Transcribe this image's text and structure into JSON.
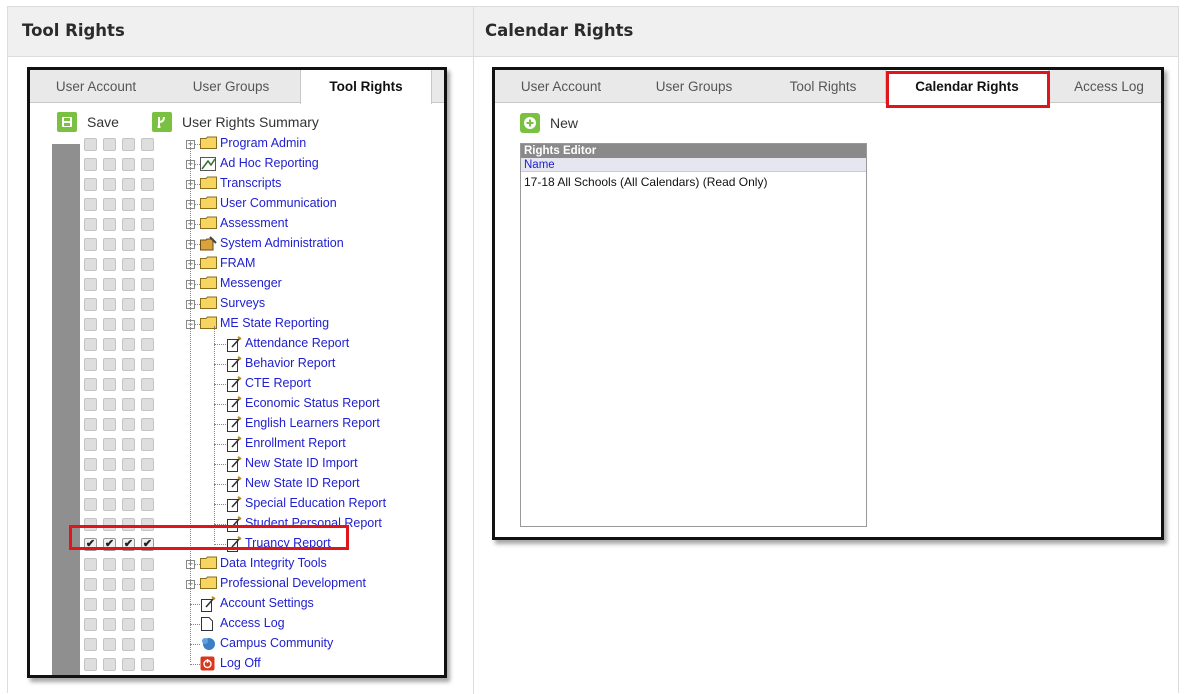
{
  "headers": {
    "left": "Tool Rights",
    "right": "Calendar Rights"
  },
  "left_shot": {
    "tabs": [
      "User Account",
      "User Groups",
      "Tool Rights"
    ],
    "active_tab": "Tool Rights",
    "toolbar": {
      "save": "Save",
      "summary": "User Rights Summary"
    },
    "tree": [
      {
        "label": "Program Admin",
        "icon": "folder-icon",
        "level": 1,
        "expander": "+",
        "checks": [
          false,
          false,
          false,
          false
        ]
      },
      {
        "label": "Ad Hoc Reporting",
        "icon": "report-icon",
        "level": 1,
        "expander": "+",
        "checks": [
          false,
          false,
          false,
          false
        ]
      },
      {
        "label": "Transcripts",
        "icon": "folder-icon",
        "level": 1,
        "expander": "+",
        "checks": [
          false,
          false,
          false,
          false
        ]
      },
      {
        "label": "User Communication",
        "icon": "folder-icon",
        "level": 1,
        "expander": "+",
        "checks": [
          false,
          false,
          false,
          false
        ]
      },
      {
        "label": "Assessment",
        "icon": "folder-icon",
        "level": 1,
        "expander": "+",
        "checks": [
          false,
          false,
          false,
          false
        ]
      },
      {
        "label": "System Administration",
        "icon": "admin-icon",
        "level": 1,
        "expander": "+",
        "checks": [
          false,
          false,
          false,
          false
        ]
      },
      {
        "label": "FRAM",
        "icon": "folder-icon",
        "level": 1,
        "expander": "+",
        "checks": [
          false,
          false,
          false,
          false
        ]
      },
      {
        "label": "Messenger",
        "icon": "folder-icon",
        "level": 1,
        "expander": "+",
        "checks": [
          false,
          false,
          false,
          false
        ]
      },
      {
        "label": "Surveys",
        "icon": "folder-icon",
        "level": 1,
        "expander": "+",
        "checks": [
          false,
          false,
          false,
          false
        ]
      },
      {
        "label": "ME State Reporting",
        "icon": "folder-icon",
        "level": 1,
        "expander": "−",
        "checks": [
          false,
          false,
          false,
          false
        ]
      },
      {
        "label": "Attendance Report",
        "icon": "tool-icon",
        "level": 2,
        "expander": "",
        "checks": [
          false,
          false,
          false,
          false
        ]
      },
      {
        "label": "Behavior Report",
        "icon": "tool-icon",
        "level": 2,
        "expander": "",
        "checks": [
          false,
          false,
          false,
          false
        ]
      },
      {
        "label": "CTE Report",
        "icon": "tool-icon",
        "level": 2,
        "expander": "",
        "checks": [
          false,
          false,
          false,
          false
        ]
      },
      {
        "label": "Economic Status Report",
        "icon": "tool-icon",
        "level": 2,
        "expander": "",
        "checks": [
          false,
          false,
          false,
          false
        ]
      },
      {
        "label": "English Learners Report",
        "icon": "tool-icon",
        "level": 2,
        "expander": "",
        "checks": [
          false,
          false,
          false,
          false
        ]
      },
      {
        "label": "Enrollment Report",
        "icon": "tool-icon",
        "level": 2,
        "expander": "",
        "checks": [
          false,
          false,
          false,
          false
        ]
      },
      {
        "label": "New State ID Import",
        "icon": "tool-icon",
        "level": 2,
        "expander": "",
        "checks": [
          false,
          false,
          false,
          false
        ]
      },
      {
        "label": "New State ID Report",
        "icon": "tool-icon",
        "level": 2,
        "expander": "",
        "checks": [
          false,
          false,
          false,
          false
        ]
      },
      {
        "label": "Special Education Report",
        "icon": "tool-icon",
        "level": 2,
        "expander": "",
        "checks": [
          false,
          false,
          false,
          false
        ]
      },
      {
        "label": "Student Personal Report",
        "icon": "tool-icon",
        "level": 2,
        "expander": "",
        "checks": [
          false,
          false,
          false,
          false
        ]
      },
      {
        "label": "Truancy Report",
        "icon": "tool-icon",
        "level": 2,
        "expander": "",
        "checks": [
          true,
          true,
          true,
          true
        ]
      },
      {
        "label": "Data Integrity Tools",
        "icon": "folder-icon",
        "level": 1,
        "expander": "+",
        "checks": [
          false,
          false,
          false,
          false
        ]
      },
      {
        "label": "Professional Development",
        "icon": "folder-icon",
        "level": 1,
        "expander": "+",
        "checks": [
          false,
          false,
          false,
          false
        ]
      },
      {
        "label": "Account Settings",
        "icon": "tool-icon",
        "level": 1,
        "expander": "",
        "checks": [
          false,
          false,
          false,
          false
        ]
      },
      {
        "label": "Access Log",
        "icon": "page-icon",
        "level": 1,
        "expander": "",
        "checks": [
          false,
          false,
          false,
          false
        ]
      },
      {
        "label": "Campus Community",
        "icon": "community-icon",
        "level": 1,
        "expander": "",
        "checks": [
          false,
          false,
          false,
          false
        ]
      },
      {
        "label": "Log Off",
        "icon": "logoff-icon",
        "level": 1,
        "expander": "",
        "checks": [
          false,
          false,
          false,
          false
        ]
      }
    ]
  },
  "right_shot": {
    "tabs": [
      "User Account",
      "User Groups",
      "Tool Rights",
      "Calendar Rights",
      "Access Log"
    ],
    "active_tab": "Calendar Rights",
    "new_label": "New",
    "rights_editor": {
      "title": "Rights Editor",
      "column": "Name",
      "rows": [
        "17-18 All Schools (All Calendars) (Read Only)"
      ]
    }
  },
  "colors": {
    "accent_green": "#7ac142",
    "highlight_red": "#e0151a",
    "link_blue": "#2020d0"
  }
}
